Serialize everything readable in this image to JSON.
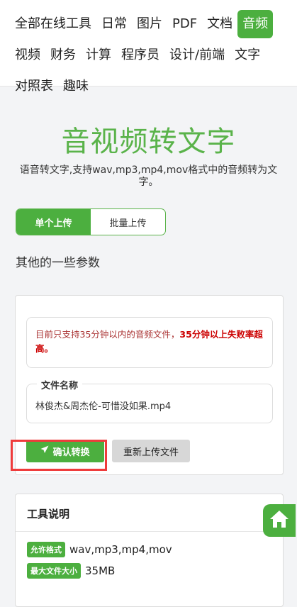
{
  "nav": {
    "items": [
      {
        "label": "全部在线工具",
        "active": false
      },
      {
        "label": "日常",
        "active": false
      },
      {
        "label": "图片",
        "active": false
      },
      {
        "label": "PDF",
        "active": false
      },
      {
        "label": "文档",
        "active": false
      },
      {
        "label": "音频",
        "active": true
      },
      {
        "label": "视频",
        "active": false
      },
      {
        "label": "财务",
        "active": false
      },
      {
        "label": "计算",
        "active": false
      },
      {
        "label": "程序员",
        "active": false
      },
      {
        "label": "设计/前端",
        "active": false
      },
      {
        "label": "文字",
        "active": false
      },
      {
        "label": "对照表",
        "active": false
      },
      {
        "label": "趣味",
        "active": false
      }
    ]
  },
  "page": {
    "title": "音视频转文字",
    "subtitle": "语音转文字,支持wav,mp3,mp4,mov格式中的音频转为文字。"
  },
  "upload_tabs": {
    "single": "单个上传",
    "batch": "批量上传"
  },
  "params_label": "其他的一些参数",
  "notice": {
    "text": "目前只支持35分钟以内的音频文件，",
    "bold": "35分钟以上失败率超高。"
  },
  "file_field": {
    "legend": "文件名称",
    "value": "林俊杰&周杰伦-可惜没如果.mp4"
  },
  "buttons": {
    "convert": "确认转换",
    "reupload": "重新上传文件"
  },
  "description": {
    "title": "工具说明",
    "rows": [
      {
        "tag": "允许格式",
        "value": "wav,mp3,mp4,mov"
      },
      {
        "tag": "最大文件大小",
        "value": "35MB"
      }
    ]
  },
  "colors": {
    "accent": "#4caf3f",
    "title_green": "#5ab34a",
    "highlight_red": "#ef3b3b",
    "warning_red": "#cc0000"
  },
  "icons": {
    "convert": "paper-plane-icon",
    "home": "home-icon"
  }
}
